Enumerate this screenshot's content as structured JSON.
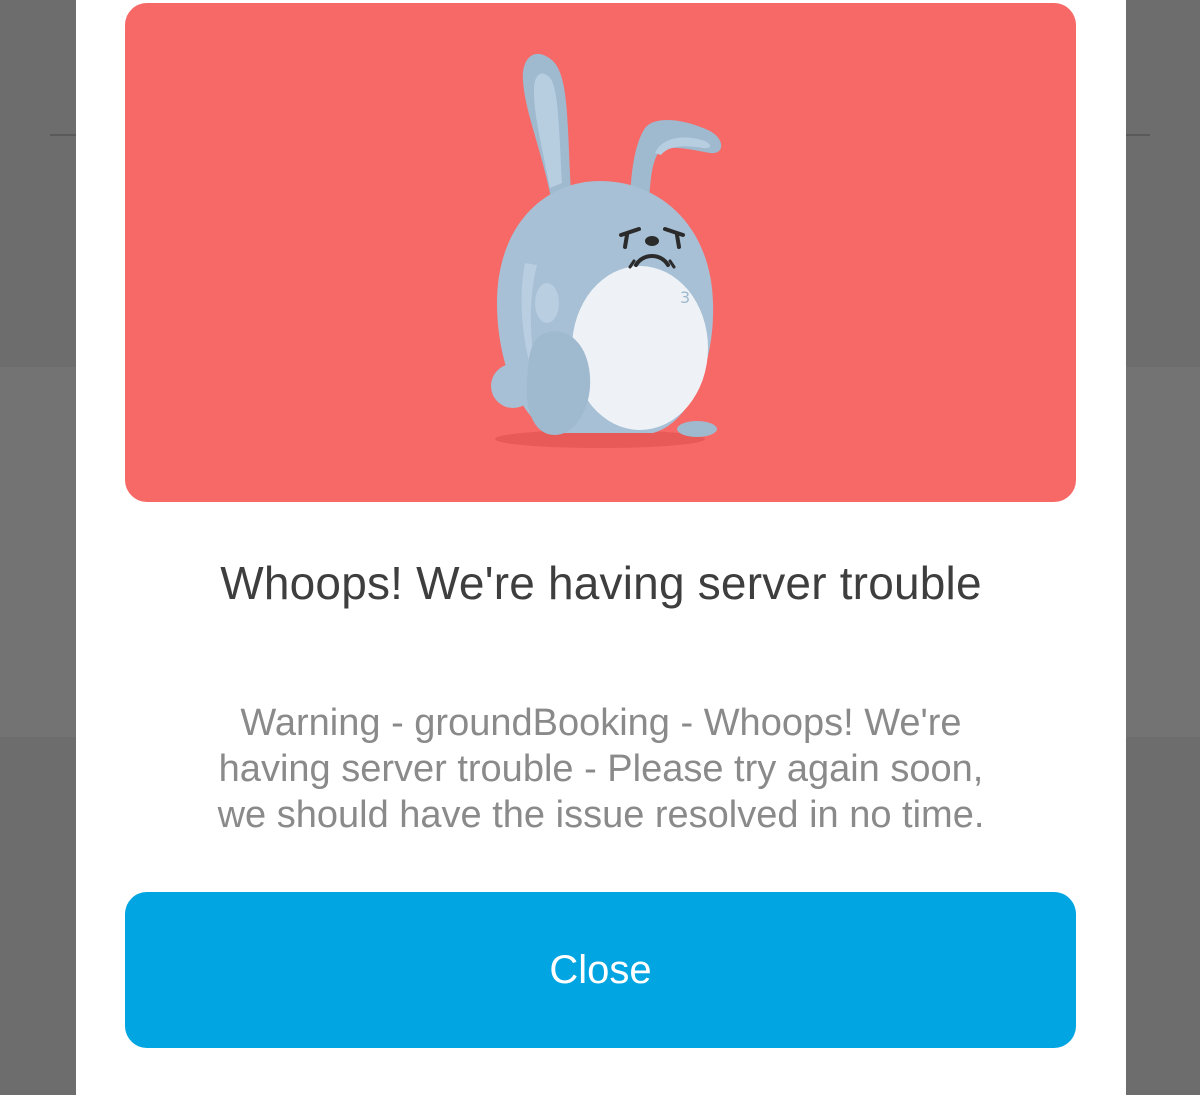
{
  "dialog": {
    "title": "Whoops! We're having server trouble",
    "message_lines": [
      "Warning - groundBooking - Whoops! We're",
      "having server trouble - Please try again soon,",
      "we should have the issue resolved in no time."
    ],
    "close_label": "Close"
  },
  "illustration": {
    "name": "sad-bunny-icon",
    "badge_text": "3"
  },
  "colors": {
    "hero_background": "#f76966",
    "button_background": "#00a5e1",
    "button_text": "#ffffff",
    "title_text": "#3e3e3e",
    "message_text": "#8a8a8a",
    "overlay": "#6d6d6d"
  }
}
